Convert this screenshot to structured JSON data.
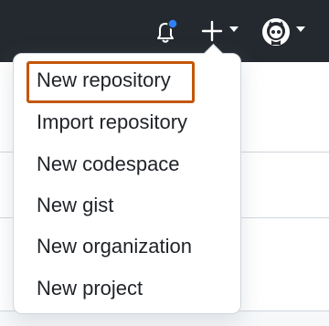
{
  "header": {
    "icons": {
      "notifications": "bell-icon",
      "notification_indicator_color": "#2f81f7",
      "create": "plus-icon",
      "create_dropdown": "chevron-down-icon",
      "avatar": "octocat-avatar",
      "avatar_dropdown": "chevron-down-icon"
    },
    "background_color": "#24292f"
  },
  "create_menu": {
    "items": [
      {
        "label": "New repository",
        "highlighted": true
      },
      {
        "label": "Import repository"
      },
      {
        "label": "New codespace"
      },
      {
        "label": "New gist"
      },
      {
        "label": "New organization"
      },
      {
        "label": "New project"
      }
    ],
    "highlight_color": "#c4560a"
  }
}
